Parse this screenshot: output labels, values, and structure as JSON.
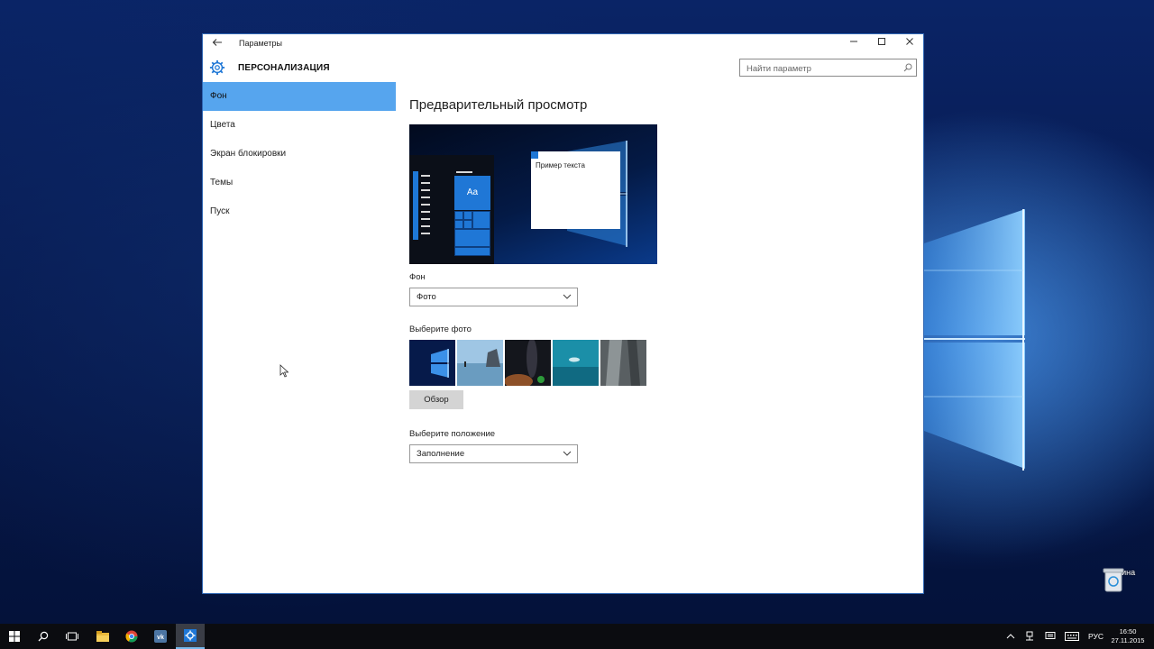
{
  "window": {
    "title": "Параметры",
    "section": "ПЕРСОНАЛИЗАЦИЯ",
    "search_placeholder": "Найти параметр"
  },
  "sidebar": {
    "items": [
      {
        "label": "Фон",
        "active": true
      },
      {
        "label": "Цвета",
        "active": false
      },
      {
        "label": "Экран блокировки",
        "active": false
      },
      {
        "label": "Темы",
        "active": false
      },
      {
        "label": "Пуск",
        "active": false
      }
    ]
  },
  "main": {
    "preview_heading": "Предварительный просмотр",
    "preview_tile_text": "Aa",
    "preview_sample_text": "Пример текста",
    "background_label": "Фон",
    "background_value": "Фото",
    "choose_photo_label": "Выберите фото",
    "browse_label": "Обзор",
    "position_label": "Выберите положение",
    "position_value": "Заполнение"
  },
  "desktop": {
    "recycle_bin_label": "Корзина"
  },
  "taskbar": {
    "language": "РУС",
    "time": "16:50",
    "date": "27.11.2015",
    "apps": [
      "start-icon",
      "search-icon",
      "task-view-icon",
      "file-explorer-icon",
      "chrome-icon",
      "vk-icon",
      "settings-icon"
    ]
  },
  "colors": {
    "accent": "#56a5ee",
    "tile_blue": "#1f77d6",
    "taskbar": "#0b0c10"
  }
}
